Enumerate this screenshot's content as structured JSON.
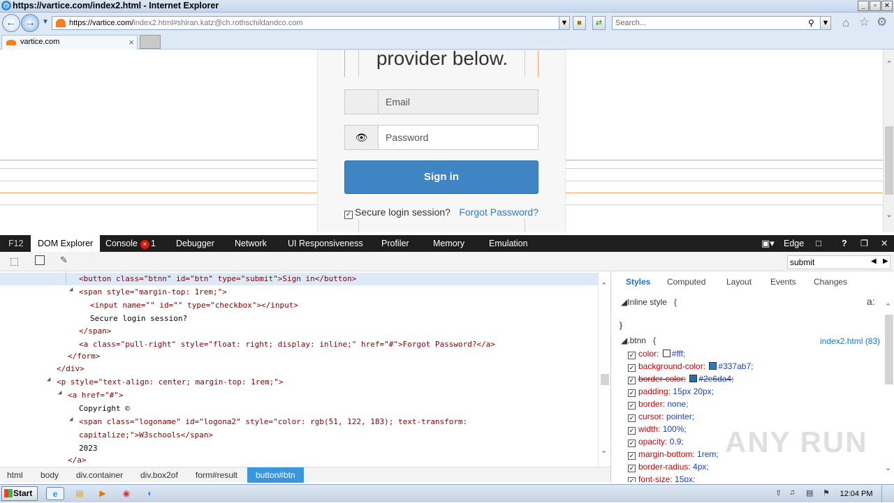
{
  "window": {
    "title": "https://vartice.com/index2.html - Internet Explorer",
    "controls": [
      "_",
      "▫",
      "✕"
    ]
  },
  "navbar": {
    "address_host": "https://vartice.com/",
    "address_path": "index2.html#shiran.katz@ch.rothschildandco.com",
    "search_placeholder": "Search..."
  },
  "tabs": [
    {
      "label": "vartice.com"
    }
  ],
  "page": {
    "heading": "provider below.",
    "email_placeholder": "Email",
    "password_placeholder": "Password",
    "signin_label": "Sign in",
    "secure_label": "Secure login session?",
    "forgot_label": "Forgot Password?"
  },
  "devtools": {
    "tabs": [
      "F12",
      "DOM Explorer",
      "Console",
      "Debugger",
      "Network",
      "UI Responsiveness",
      "Profiler",
      "Memory",
      "Emulation"
    ],
    "console_errors": "1",
    "mode": "Edge",
    "find_value": "submit",
    "dom_lines": [
      {
        "t": "<button class=\"btnn\" id=\"btn\" type=\"submit\">Sign in</button>"
      },
      {
        "t": "<span style=\"margin-top: 1rem;\">"
      },
      {
        "t": "<input name=\"\" id=\"\" type=\"checkbox\"></input>"
      },
      {
        "t": "Secure login session?"
      },
      {
        "t": "</span>"
      },
      {
        "t": "<a class=\"pull-right\" style=\"float: right; display: inline;\" href=\"#\">Forgot Password?</a>"
      },
      {
        "t": "</form>"
      },
      {
        "t": "</div>"
      },
      {
        "t": "<p style=\"text-align: center; margin-top: 1rem;\">"
      },
      {
        "t": "<a href=\"#\">"
      },
      {
        "t": "Copyright ©"
      },
      {
        "t": "<span class=\"logoname\" id=\"logona2\" style=\"color: rgb(51, 122, 183); text-transform:"
      },
      {
        "t": "capitalize;\">W3schools</span>"
      },
      {
        "t": "2023"
      },
      {
        "t": "</a>"
      }
    ],
    "style_tabs": [
      "Styles",
      "Computed",
      "Layout",
      "Events",
      "Changes"
    ],
    "inline_style_label": "Inline style",
    "open_brace": "{",
    "close_brace": "}",
    "rule_selector": ".btnn",
    "rule_source": "index2.html (83)",
    "properties": [
      {
        "name": "color:",
        "value": "#fff;",
        "swatch": "#ffffff"
      },
      {
        "name": "background-color:",
        "value": "#337ab7;",
        "swatch": "#337ab7"
      },
      {
        "name": "border-color:",
        "value": "#2e6da4;",
        "swatch": "#2e6da4",
        "struck": true
      },
      {
        "name": "padding:",
        "value": "15px 20px;"
      },
      {
        "name": "border:",
        "value": "none;"
      },
      {
        "name": "cursor:",
        "value": "pointer;"
      },
      {
        "name": "width:",
        "value": "100%;"
      },
      {
        "name": "opacity:",
        "value": "0.9;"
      },
      {
        "name": "margin-bottom:",
        "value": "1rem;"
      },
      {
        "name": "border-radius:",
        "value": "4px;"
      },
      {
        "name": "font-size:",
        "value": "15px;"
      }
    ],
    "breadcrumb": [
      "html",
      "body",
      "div.container",
      "div.box2of",
      "form#result",
      "button#btn"
    ]
  },
  "taskbar": {
    "start_label": "Start",
    "clock": "12:04 PM"
  },
  "watermark": "ANY RUN"
}
